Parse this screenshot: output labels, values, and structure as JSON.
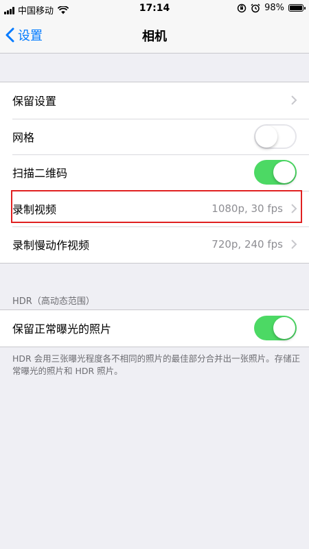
{
  "status_bar": {
    "carrier": "中国移动",
    "time": "17:14",
    "battery": "98%",
    "battery_level": 0.98
  },
  "nav": {
    "back_label": "设置",
    "title": "相机"
  },
  "group1": {
    "items": [
      {
        "label": "保留设置",
        "value": "",
        "type": "chevron"
      },
      {
        "label": "网格",
        "value": "",
        "type": "toggle",
        "on": false
      },
      {
        "label": "扫描二维码",
        "value": "",
        "type": "toggle",
        "on": true
      },
      {
        "label": "录制视频",
        "value": "1080p, 30 fps",
        "type": "chevron"
      },
      {
        "label": "录制慢动作视频",
        "value": "720p, 240 fps",
        "type": "chevron"
      }
    ]
  },
  "hdr_section": {
    "header": "HDR（高动态范围）",
    "items": [
      {
        "label": "保留正常曝光的照片",
        "type": "toggle",
        "on": true
      }
    ],
    "footer": "HDR 会用三张曝光程度各不相同的照片的最佳部分合并出一张照片。存储正常曝光的照片和 HDR 照片。"
  },
  "colors": {
    "accent": "#007aff",
    "toggle_on": "#4cd964",
    "highlight": "#e02020"
  }
}
